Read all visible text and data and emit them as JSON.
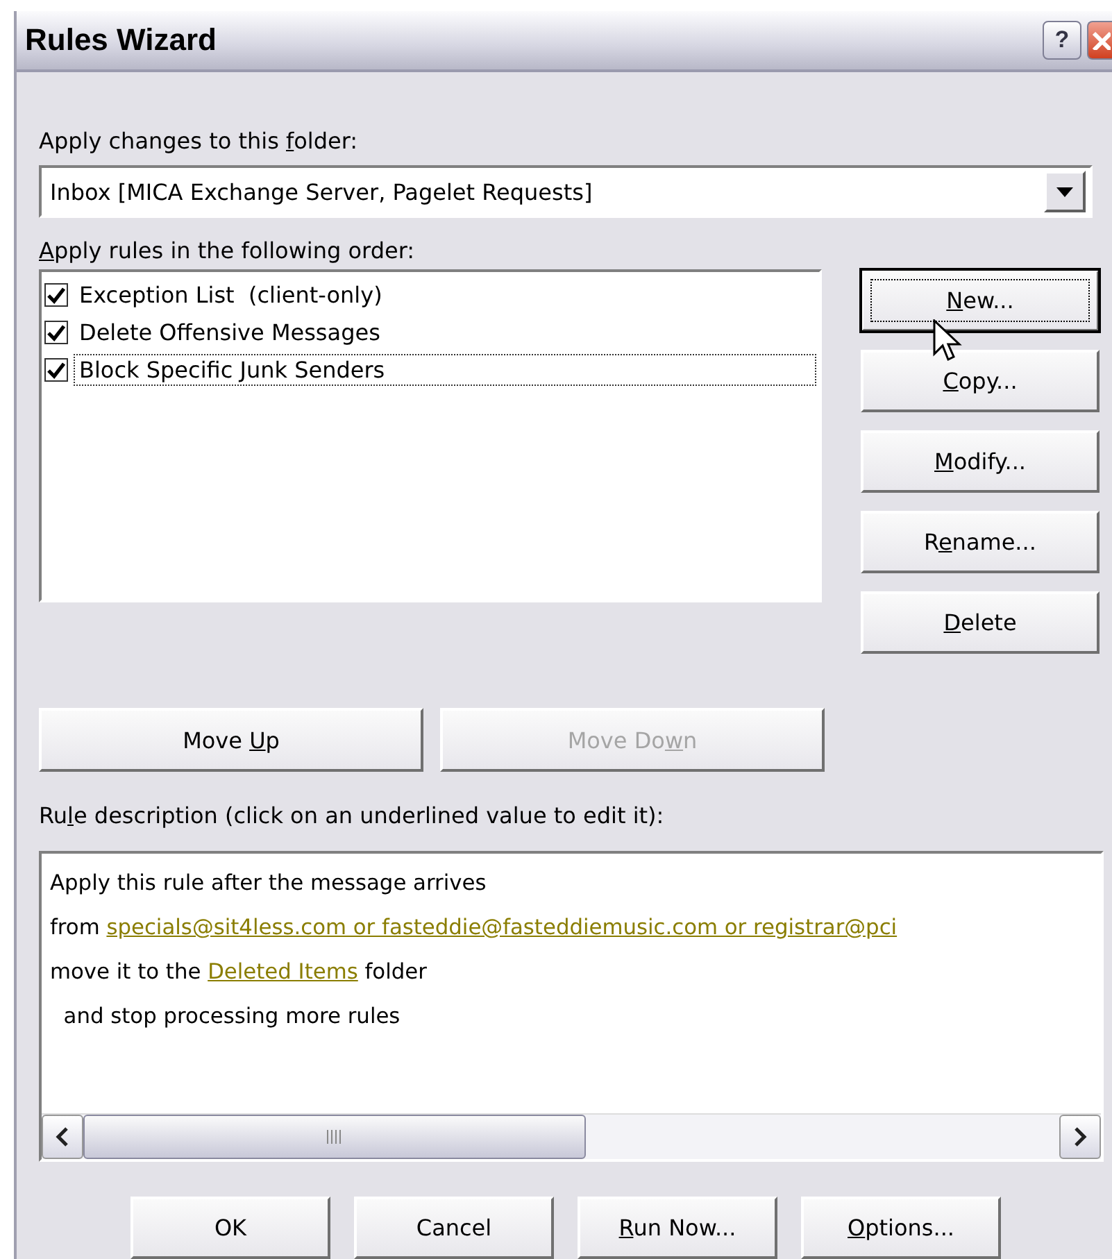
{
  "window": {
    "title": "Rules Wizard"
  },
  "title_buttons": [
    {
      "kind": "help",
      "label": "?"
    },
    {
      "kind": "close"
    }
  ],
  "folder": {
    "label": {
      "pre": "Apply changes to this ",
      "key": "f",
      "post": "older:"
    },
    "value": "Inbox [MICA Exchange Server, Pagelet Requests]"
  },
  "rules_label": {
    "key": "A",
    "post": "pply rules in the following order:"
  },
  "rules": [
    {
      "name": "Exception List  (client-only)",
      "checked": true,
      "focused": false
    },
    {
      "name": "Delete Offensive Messages",
      "checked": true,
      "focused": false
    },
    {
      "name": "Block Specific Junk Senders",
      "checked": true,
      "focused": true
    }
  ],
  "side_buttons": [
    {
      "key": "N",
      "post": "ew...",
      "focused": true
    },
    {
      "key": "C",
      "post": "opy...",
      "focused": false
    },
    {
      "key": "M",
      "post": "odify...",
      "focused": false
    },
    {
      "pre": "R",
      "key": "e",
      "post": "name...",
      "focused": false
    },
    {
      "key": "D",
      "post": "elete",
      "focused": false
    }
  ],
  "order_buttons": [
    {
      "pre": "Move ",
      "key": "U",
      "post": "p",
      "disabled": false
    },
    {
      "pre": "Move Do",
      "key": "w",
      "post": "n",
      "disabled": true
    }
  ],
  "description_label": {
    "pre": "Ru",
    "key": "l",
    "post": "e description (click on an underlined value to edit it):"
  },
  "description": [
    {
      "parts": [
        {
          "kind": "text",
          "text": "Apply this rule after the message arrives"
        }
      ]
    },
    {
      "parts": [
        {
          "kind": "text",
          "text": "from "
        },
        {
          "kind": "link",
          "text": "specials@sit4less.com or fasteddie@fasteddiemusic.com or registrar@pci"
        }
      ]
    },
    {
      "parts": [
        {
          "kind": "text",
          "text": "move it to the "
        },
        {
          "kind": "link",
          "text": "Deleted Items"
        },
        {
          "kind": "text",
          "text": " folder"
        }
      ]
    },
    {
      "parts": [
        {
          "kind": "text",
          "text": "  and stop processing more rules"
        }
      ]
    }
  ],
  "footer_buttons": [
    {
      "pre": "OK"
    },
    {
      "pre": "Cancel"
    },
    {
      "key": "R",
      "post": "un Now..."
    },
    {
      "key": "O",
      "post": "ptions..."
    }
  ]
}
